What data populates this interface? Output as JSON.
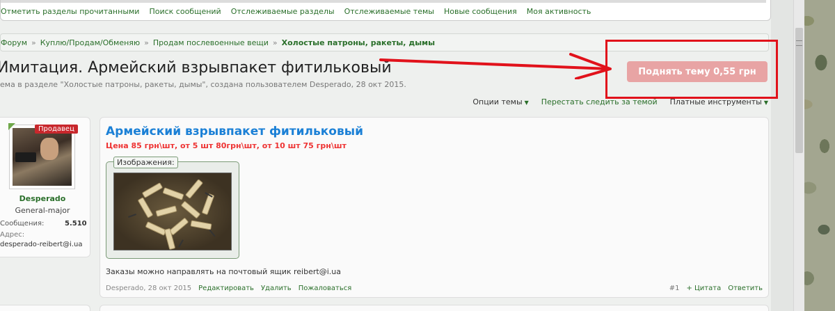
{
  "nav": {
    "links": [
      "Отметить разделы прочитанными",
      "Поиск сообщений",
      "Отслеживаемые разделы",
      "Отслеживаемые темы",
      "Новые сообщения",
      "Моя активность"
    ]
  },
  "breadcrumb": {
    "items": [
      "Форум",
      "Куплю/Продам/Обменяю",
      "Продам послевоенные вещи"
    ],
    "separator": "»",
    "current": "Холостые патроны, ракеты, дымы"
  },
  "thread": {
    "title": "Имитация. Армейский взрывпакет фитильковый",
    "description": "ема в разделе \"Холостые патроны, ракеты, дымы\", создана пользователем Desperado, 28 окт 2015."
  },
  "bump_button": {
    "label": "Поднять тему 0,55 грн"
  },
  "thread_tools": {
    "options": "Опции темы",
    "unwatch": "Перестать следить за темой",
    "paid_tools": "Платные инструменты"
  },
  "user": {
    "badge": "Продавец",
    "name": "Desperado",
    "rank": "General-major",
    "messages_label": "Сообщения:",
    "messages_value": "5.510",
    "address_label": "Адрес:",
    "address_value": "desperado-reibert@i.ua"
  },
  "post": {
    "title": "Армейский взрывпакет фитильковый",
    "price": "Цена 85 грн\\шт, от 5 шт 80грн\\шт, от 10 шт 75 грн\\шт",
    "attachments_label": "Изображения:",
    "body": "Заказы можно направлять на почтовый ящик reibert@i.ua",
    "author": "Desperado",
    "date": "28 окт 2015",
    "edit": "Редактировать",
    "delete": "Удалить",
    "report": "Пожаловаться",
    "number": "#1",
    "quote": "+ Цитата",
    "reply": "Ответить"
  },
  "colors": {
    "accent_green": "#2a6f2a",
    "title_blue": "#1b80d6",
    "price_red": "#e33333",
    "annotation_red": "#e1121b",
    "bump_button_bg": "#e8a4a4"
  }
}
